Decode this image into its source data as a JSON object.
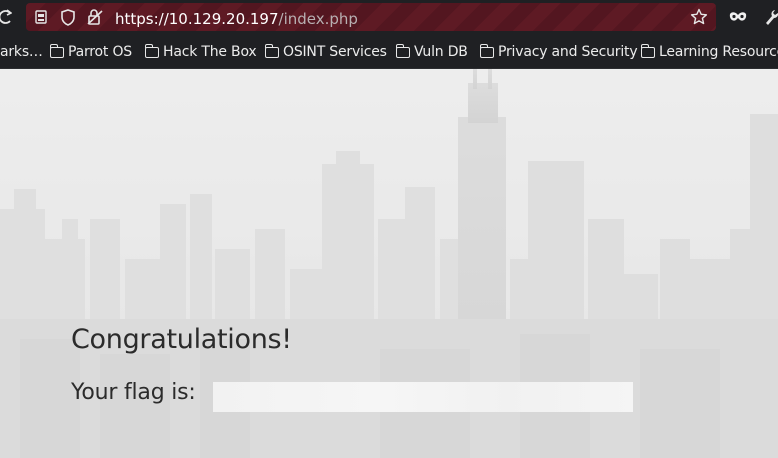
{
  "browser": {
    "url_host": "https://10.129.20.197",
    "url_path": "/index.php"
  },
  "bookmarks": {
    "truncated_label": "arks…",
    "items": [
      {
        "label": "Parrot OS"
      },
      {
        "label": "Hack The Box"
      },
      {
        "label": "OSINT Services"
      },
      {
        "label": "Vuln DB"
      },
      {
        "label": "Privacy and Security"
      },
      {
        "label": "Learning Resource"
      }
    ]
  },
  "page": {
    "heading": "Congratulations!",
    "flag_label": "Your flag is:",
    "flag_value": ""
  },
  "colors": {
    "toolbar_bg": "#1f2023",
    "urlbar_bg": "#5e1a24",
    "page_text": "#2b2b2b"
  }
}
